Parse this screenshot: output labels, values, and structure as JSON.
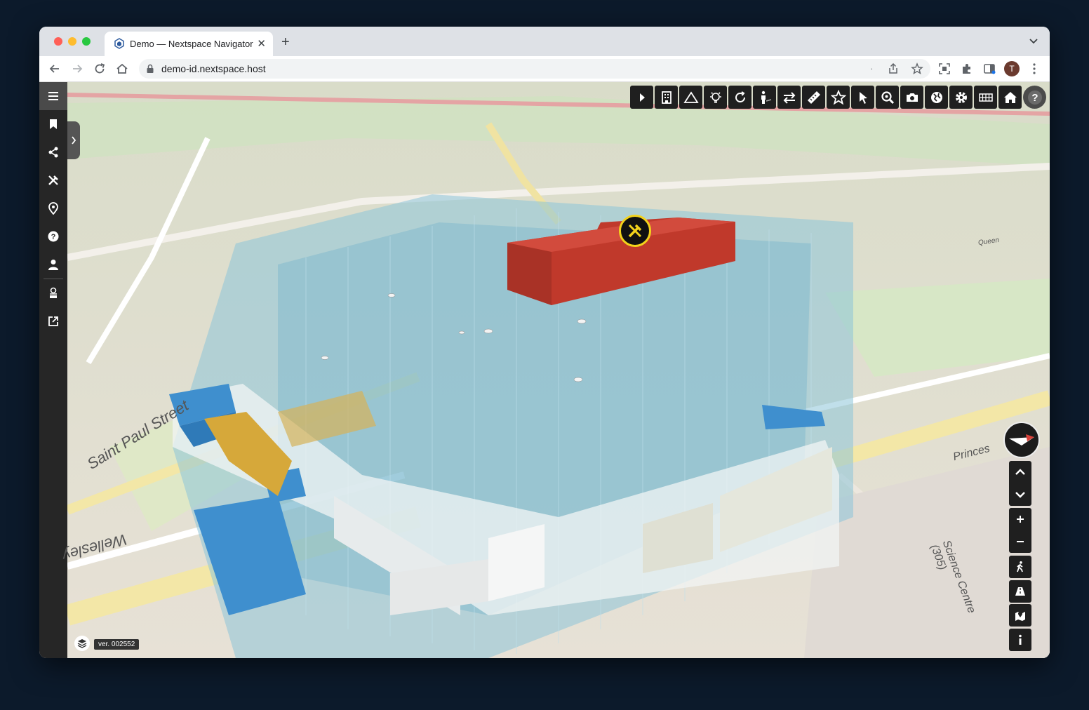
{
  "browser": {
    "tab_title": "Demo — Nextspace Navigator",
    "tab_close": "✕",
    "new_tab": "+",
    "url": "demo-id.nextspace.host",
    "omnibox_dot": ".",
    "profile_initial": "T"
  },
  "sidebar": {
    "items": [
      {
        "name": "menu",
        "icon": "menu-icon"
      },
      {
        "name": "bookmarks",
        "icon": "bookmark-icon"
      },
      {
        "name": "share",
        "icon": "share-icon"
      },
      {
        "name": "tools",
        "icon": "tools-icon"
      },
      {
        "name": "location",
        "icon": "location-pin-icon"
      },
      {
        "name": "help",
        "icon": "help-icon"
      },
      {
        "name": "account",
        "icon": "user-icon"
      },
      {
        "name": "viewer",
        "icon": "viewer-icon"
      },
      {
        "name": "open-external",
        "icon": "external-link-icon"
      }
    ]
  },
  "toolbar": {
    "tools": [
      "play-icon",
      "building-icon",
      "terrain-icon",
      "lightbulb-icon",
      "rotate-icon",
      "person-icon",
      "swap-icon",
      "measure-ruler-icon",
      "star-icon",
      "cursor-icon",
      "zoom-icon",
      "camera-icon",
      "globe-icon",
      "gear-icon",
      "grid-icon",
      "home-icon",
      "help-icon"
    ]
  },
  "map": {
    "version": "ver. 002552",
    "labels": {
      "street_1": "Saint Paul Street",
      "street_2": "Wellesley",
      "street_3": "Princes",
      "building": "Science Centre (305)",
      "street_4": "Queen"
    },
    "colors": {
      "highlight_red": "#c0392b",
      "highlight_blue": "#3f8fce",
      "highlight_yellow": "#d6a83a",
      "glass": "#8cc4d8",
      "marker_ring": "#f2d21b"
    }
  }
}
